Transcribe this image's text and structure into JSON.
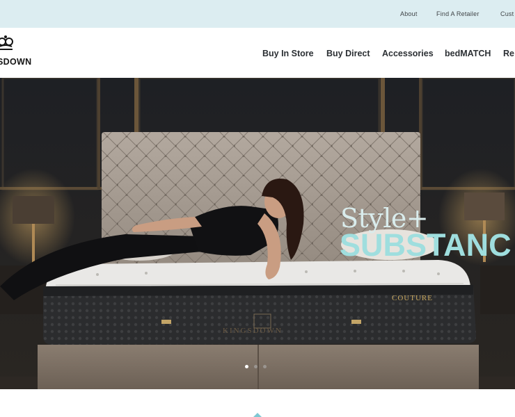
{
  "utility_nav": {
    "links": [
      {
        "label": "About"
      },
      {
        "label": "Find A Retailer"
      },
      {
        "label": "Cust"
      }
    ]
  },
  "brand": {
    "name": "KINGSDOWN",
    "visible_wordmark": "SDOWN"
  },
  "main_nav": {
    "items": [
      {
        "label": "Buy In Store"
      },
      {
        "label": "Buy Direct"
      },
      {
        "label": "Accessories"
      },
      {
        "label": "bedMATCH"
      },
      {
        "label": "Re"
      }
    ]
  },
  "hero": {
    "headline_line1": "Style+",
    "headline_line2": "SUBSTANC",
    "mattress_label": "COUTURE",
    "mattress_brand": "KINGSDOWN",
    "slides_total": 3,
    "active_slide": 1
  },
  "colors": {
    "utility_bar": "#dcedf1",
    "accent": "#7fc8d3",
    "headline": "#9fdede",
    "gold": "#c9a85e"
  },
  "icons": {
    "logo_crown": "crown-icon",
    "scroll_indicator": "chevron-up-icon"
  }
}
